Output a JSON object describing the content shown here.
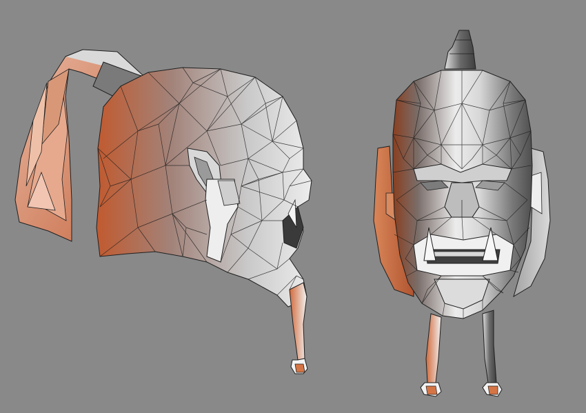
{
  "scene": {
    "background_color": "#898989",
    "shade_light": "#f2f2f2",
    "shade_mid": "#b9b9b9",
    "shade_dark": "#5c5c5c",
    "accent_orange": "#d2683a",
    "wire_color": "#1e1e1e",
    "views": [
      "side-profile",
      "front"
    ]
  }
}
